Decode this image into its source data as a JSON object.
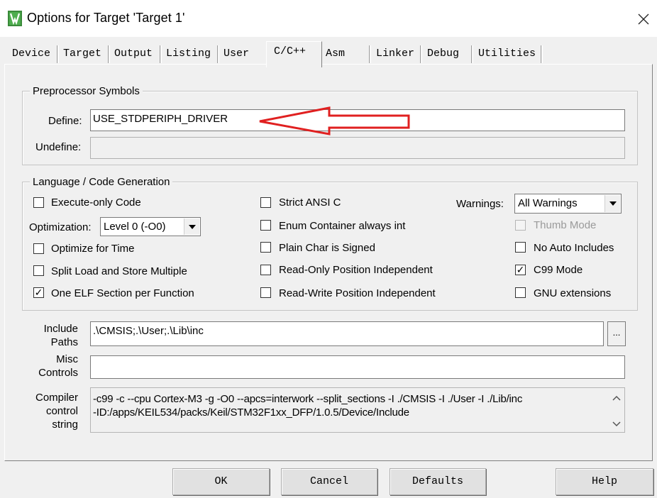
{
  "window": {
    "title": "Options for Target 'Target 1'",
    "icon": "keil-uvision-icon"
  },
  "tabs": [
    {
      "label": "Device"
    },
    {
      "label": "Target"
    },
    {
      "label": "Output"
    },
    {
      "label": "Listing"
    },
    {
      "label": "User"
    },
    {
      "label": "C/C++",
      "active": true
    },
    {
      "label": "Asm"
    },
    {
      "label": "Linker"
    },
    {
      "label": "Debug"
    },
    {
      "label": "Utilities"
    }
  ],
  "preprocessor": {
    "group_label": "Preprocessor Symbols",
    "define_label": "Define:",
    "define_value": "USE_STDPERIPH_DRIVER",
    "undefine_label": "Undefine:",
    "undefine_value": ""
  },
  "language": {
    "group_label": "Language / Code Generation",
    "execute_only": {
      "label": "Execute-only Code",
      "checked": false
    },
    "optimization_label": "Optimization:",
    "optimization_value": "Level 0 (-O0)",
    "optimize_time": {
      "label": "Optimize for Time",
      "checked": false
    },
    "split_load": {
      "label": "Split Load and Store Multiple",
      "checked": false
    },
    "one_elf": {
      "label": "One ELF Section per Function",
      "checked": true
    },
    "strict_ansi": {
      "label": "Strict ANSI C",
      "checked": false
    },
    "enum_container": {
      "label": "Enum Container always int",
      "checked": false
    },
    "plain_char": {
      "label": "Plain Char is Signed",
      "checked": false
    },
    "ro_pi": {
      "label": "Read-Only Position Independent",
      "checked": false
    },
    "rw_pi": {
      "label": "Read-Write Position Independent",
      "checked": false
    },
    "warnings_label": "Warnings:",
    "warnings_value": "All Warnings",
    "thumb_mode": {
      "label": "Thumb Mode",
      "checked": false,
      "disabled": true
    },
    "no_auto_includes": {
      "label": "No Auto Includes",
      "checked": false
    },
    "c99_mode": {
      "label": "C99 Mode",
      "checked": true
    },
    "gnu_ext": {
      "label": "GNU extensions",
      "checked": false
    }
  },
  "include": {
    "label_line1": "Include",
    "label_line2": "Paths",
    "value": ".\\CMSIS;.\\User;.\\Lib\\inc",
    "browse_label": "..."
  },
  "misc": {
    "label_line1": "Misc",
    "label_line2": "Controls",
    "value": ""
  },
  "compiler": {
    "label_line1": "Compiler",
    "label_line2": "control",
    "label_line3": "string",
    "line1": "-c99 -c --cpu Cortex-M3 -g -O0 --apcs=interwork --split_sections -I ./CMSIS -I ./User -I ./Lib/inc",
    "line2": "-ID:/apps/KEIL534/packs/Keil/STM32F1xx_DFP/1.0.5/Device/Include"
  },
  "buttons": {
    "ok": "OK",
    "cancel": "Cancel",
    "defaults": "Defaults",
    "help": "Help"
  },
  "colors": {
    "annotation_arrow": "#e02020",
    "window_bg": "#f0f0f0"
  }
}
